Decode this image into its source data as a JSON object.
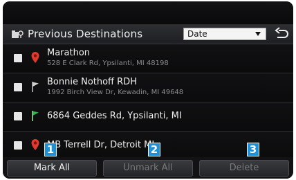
{
  "header": {
    "title": "Previous Destinations",
    "sort": {
      "selected": "Date"
    }
  },
  "destinations": [
    {
      "name": "Marathon",
      "address": "528 E Clark Rd, Ypsilanti, MI 48198",
      "icon": "map-pin-icon",
      "icon_color": "#e03a2f",
      "checked": false
    },
    {
      "name": "Bonnie Nothoff RDH",
      "address": "1992 Birch View Dr, Kewadin, MI 49648",
      "icon": "flag-icon",
      "icon_color": "#cfcfcf",
      "checked": false
    },
    {
      "name": "6864 Geddes Rd, Ypsilanti, MI",
      "address": "",
      "icon": "flag-icon",
      "icon_color": "#2fb34a",
      "checked": false
    },
    {
      "name": "MB Terrell Dr, Detroit MI",
      "address": "",
      "icon": "map-pin-icon",
      "icon_color": "#e03a2f",
      "checked": false
    }
  ],
  "footer": {
    "mark_all": "Mark All",
    "unmark_all": "Unmark All",
    "delete": "Delete"
  },
  "callouts": [
    "1",
    "2",
    "3"
  ],
  "colors": {
    "callout": "#1f8fd6",
    "background": "#0c0c0e"
  }
}
